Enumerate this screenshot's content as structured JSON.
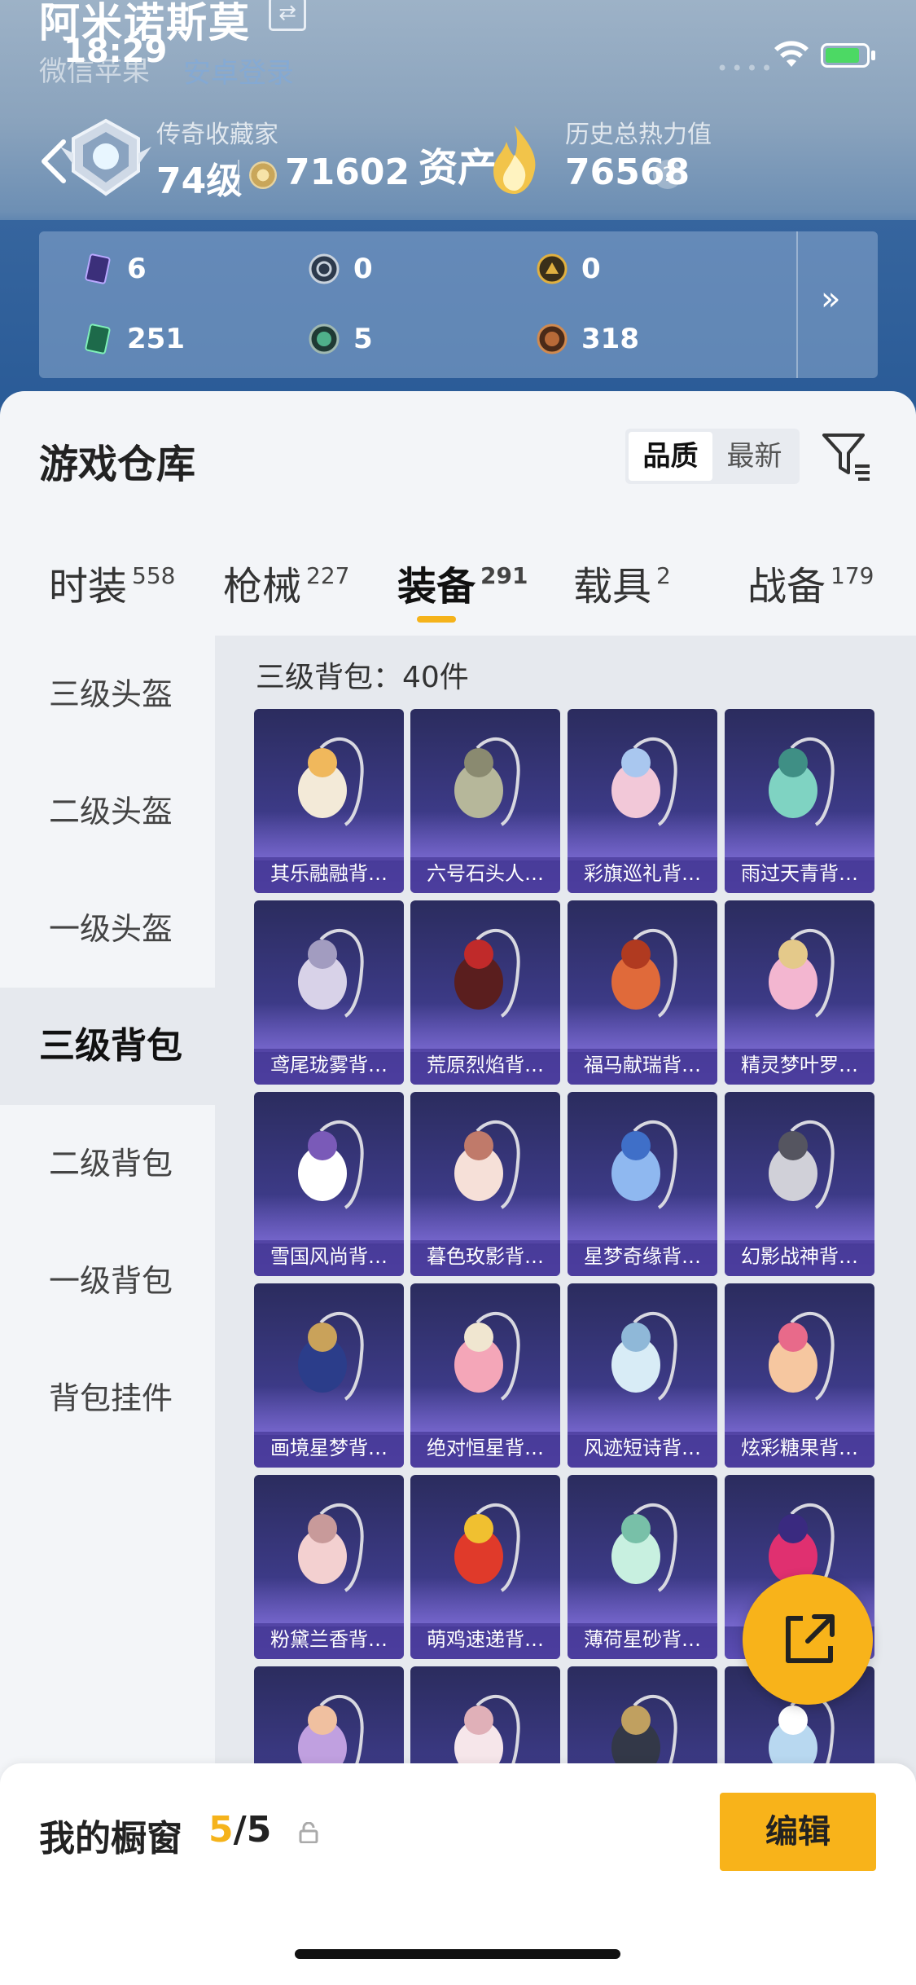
{
  "status_bar": {
    "time": "18:29"
  },
  "header": {
    "player_name": "阿米诺斯莫",
    "source_label": "微信苹果",
    "source_detail": "安卓登录",
    "rank_title": "传奇收藏家",
    "level": "74级",
    "coins": "71602",
    "assets_label": "资产",
    "heat_label": "历史总热力值",
    "heat_value": "76568",
    "help": "?"
  },
  "stats": [
    {
      "icon": "purple-card-icon",
      "value": "6"
    },
    {
      "icon": "silver-medal-icon",
      "value": "0"
    },
    {
      "icon": "gold-medal-icon",
      "value": "0"
    },
    {
      "icon": "green-card-icon",
      "value": "251"
    },
    {
      "icon": "green-orb-icon",
      "value": "5"
    },
    {
      "icon": "bronze-orb-icon",
      "value": "318"
    }
  ],
  "stats_more": "»",
  "warehouse": {
    "title": "游戏仓库",
    "sort_options": [
      "品质",
      "最新"
    ],
    "sort_selected": "品质"
  },
  "tabs": [
    {
      "label": "时装",
      "count": "558"
    },
    {
      "label": "枪械",
      "count": "227"
    },
    {
      "label": "装备",
      "count": "291"
    },
    {
      "label": "载具",
      "count": "2"
    },
    {
      "label": "战备",
      "count": "179"
    }
  ],
  "active_tab": "装备",
  "left_nav": [
    "三级头盔",
    "二级头盔",
    "一级头盔",
    "三级背包",
    "二级背包",
    "一级背包",
    "背包挂件"
  ],
  "active_nav": "三级背包",
  "content_title": "三级背包：40件",
  "items": [
    "其乐融融背…",
    "六号石头人…",
    "彩旗巡礼背…",
    "雨过天青背…",
    "鸢尾珑雾背…",
    "荒原烈焰背…",
    "福马献瑞背…",
    "精灵梦叶罗…",
    "雪国风尚背…",
    "暮色玫影背…",
    "星梦奇缘背…",
    "幻影战神背…",
    "画境星梦背…",
    "绝对恒星背…",
    "风迹短诗背…",
    "炫彩糖果背…",
    "粉黛兰香背…",
    "萌鸡速递背…",
    "薄荷星砂背…",
    "",
    "",
    "",
    "",
    ""
  ],
  "item_colors": [
    [
      "#f3ead8",
      "#f0b85c"
    ],
    [
      "#b6b79a",
      "#8a8a70"
    ],
    [
      "#f2c8d8",
      "#a9c7ef"
    ],
    [
      "#7fd3c2",
      "#3f8f85"
    ],
    [
      "#d8d2e8",
      "#a29cc0"
    ],
    [
      "#5a1e1e",
      "#c02a2a"
    ],
    [
      "#e06a3a",
      "#b03a20"
    ],
    [
      "#f3b6d0",
      "#e4c98a"
    ],
    [
      "#ffffff",
      "#7a5ab8"
    ],
    [
      "#f6e0d8",
      "#c07a6a"
    ],
    [
      "#8fb8f0",
      "#3f6fc8"
    ],
    [
      "#d0d0d8",
      "#555560"
    ],
    [
      "#2b3d8a",
      "#c9a25a"
    ],
    [
      "#f4a6b8",
      "#f0e6d0"
    ],
    [
      "#d8ecf6",
      "#8fb8d8"
    ],
    [
      "#f6c7a0",
      "#e86a8a"
    ],
    [
      "#f3d0d0",
      "#c89a9a"
    ],
    [
      "#e03a2a",
      "#f0c030"
    ],
    [
      "#c8f0e0",
      "#78c0a8"
    ],
    [
      "#e03070",
      "#3a2a80"
    ],
    [
      "#c0a0e0",
      "#f0c0a0"
    ],
    [
      "#f6e6ea",
      "#e0b0b8"
    ],
    [
      "#333848",
      "#c0a060"
    ],
    [
      "#b8d8f0",
      "#ffffff"
    ]
  ],
  "showcase": {
    "label": "我的橱窗",
    "current": "5",
    "total": "/5",
    "edit": "编辑"
  },
  "colors": {
    "accent": "#f8b31a",
    "card_dark": "#2b2c5e",
    "card_light": "#5b4cb3"
  }
}
